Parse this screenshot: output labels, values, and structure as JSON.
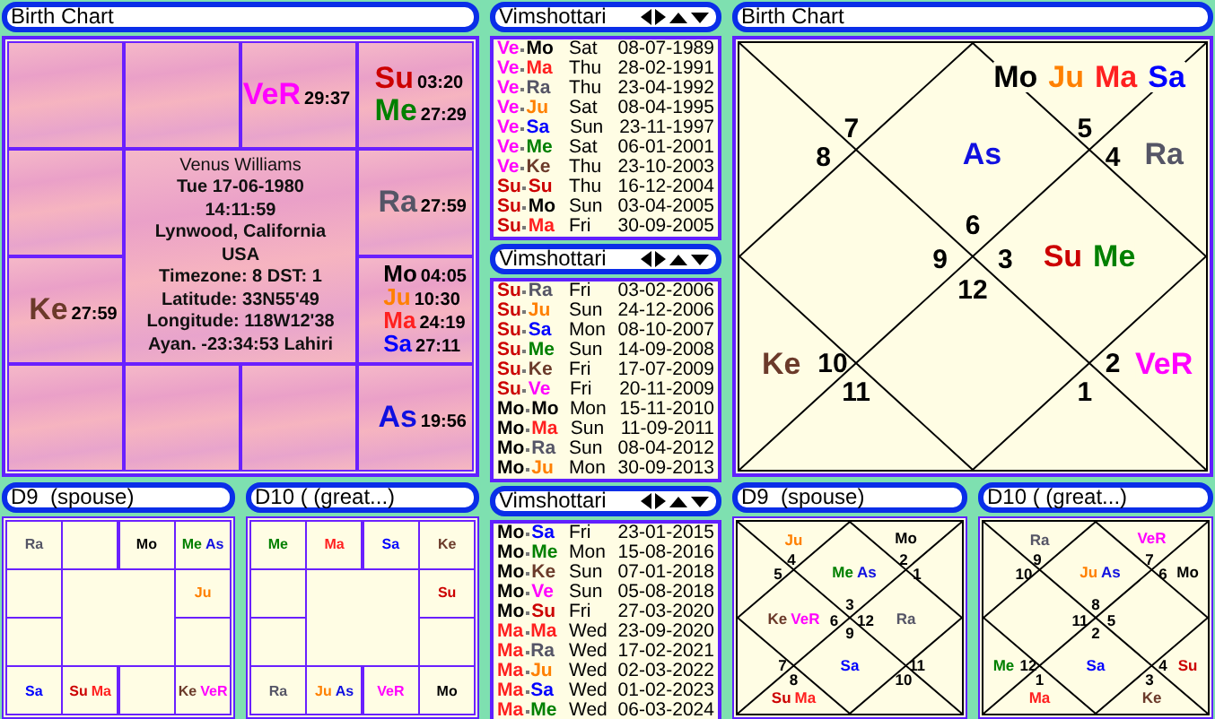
{
  "birth_chart_south": {
    "title": "Birth Chart",
    "name": "Venus Williams",
    "details": [
      "Tue 17-06-1980",
      "14:11:59",
      "Lynwood, California",
      "USA",
      "Timezone: 8 DST: 1",
      "Latitude: 33N55'49",
      "Longitude: 118W12'38",
      "Ayan. -23:34:53 Lahiri"
    ],
    "cells": [
      {},
      {},
      {
        "planets": [
          {
            "name": "VeR",
            "degree": "29:37",
            "color": "#ff00ff"
          }
        ]
      },
      {
        "planets": [
          {
            "name": "Su",
            "degree": "03:20",
            "color": "#cc0000"
          },
          {
            "name": "Me",
            "degree": "27:29",
            "color": "#008000"
          }
        ]
      },
      {},
      {
        "planets": [
          {
            "name": "Ra",
            "degree": "27:59",
            "color": "#555566"
          }
        ]
      },
      {
        "planets": [
          {
            "name": "Ke",
            "degree": "27:59",
            "color": "#6b3a2a"
          }
        ]
      },
      {
        "planets": [
          {
            "name": "Mo",
            "degree": "04:05",
            "color": "#000000"
          },
          {
            "name": "Ju",
            "degree": "10:30",
            "color": "#ff8000"
          },
          {
            "name": "Ma",
            "degree": "24:19",
            "color": "#ff2020"
          },
          {
            "name": "Sa",
            "degree": "27:11",
            "color": "#0000ff"
          }
        ]
      },
      {},
      {},
      {},
      {
        "planets": [
          {
            "name": "As",
            "degree": "19:56",
            "color": "#1010e0"
          }
        ]
      }
    ]
  },
  "dasha_lists": [
    {
      "title": "Vimshottari",
      "rows": [
        {
          "lords": [
            {
              "name": "Ve",
              "color": "#ff00ff"
            },
            {
              "name": "Mo",
              "color": "#000000"
            }
          ],
          "day": "Sat",
          "date": "08-07-1989"
        },
        {
          "lords": [
            {
              "name": "Ve",
              "color": "#ff00ff"
            },
            {
              "name": "Ma",
              "color": "#ff2020"
            }
          ],
          "day": "Thu",
          "date": "28-02-1991"
        },
        {
          "lords": [
            {
              "name": "Ve",
              "color": "#ff00ff"
            },
            {
              "name": "Ra",
              "color": "#555566"
            }
          ],
          "day": "Thu",
          "date": "23-04-1992"
        },
        {
          "lords": [
            {
              "name": "Ve",
              "color": "#ff00ff"
            },
            {
              "name": "Ju",
              "color": "#ff8000"
            }
          ],
          "day": "Sat",
          "date": "08-04-1995"
        },
        {
          "lords": [
            {
              "name": "Ve",
              "color": "#ff00ff"
            },
            {
              "name": "Sa",
              "color": "#0000ff"
            }
          ],
          "day": "Sun",
          "date": "23-11-1997"
        },
        {
          "lords": [
            {
              "name": "Ve",
              "color": "#ff00ff"
            },
            {
              "name": "Me",
              "color": "#008000"
            }
          ],
          "day": "Sat",
          "date": "06-01-2001"
        },
        {
          "lords": [
            {
              "name": "Ve",
              "color": "#ff00ff"
            },
            {
              "name": "Ke",
              "color": "#6b3a2a"
            }
          ],
          "day": "Thu",
          "date": "23-10-2003"
        },
        {
          "lords": [
            {
              "name": "Su",
              "color": "#cc0000"
            },
            {
              "name": "Su",
              "color": "#cc0000"
            }
          ],
          "day": "Thu",
          "date": "16-12-2004"
        },
        {
          "lords": [
            {
              "name": "Su",
              "color": "#cc0000"
            },
            {
              "name": "Mo",
              "color": "#000000"
            }
          ],
          "day": "Sun",
          "date": "03-04-2005"
        },
        {
          "lords": [
            {
              "name": "Su",
              "color": "#cc0000"
            },
            {
              "name": "Ma",
              "color": "#ff2020"
            }
          ],
          "day": "Fri",
          "date": "30-09-2005"
        }
      ]
    },
    {
      "title": "Vimshottari",
      "rows": [
        {
          "lords": [
            {
              "name": "Su",
              "color": "#cc0000"
            },
            {
              "name": "Ra",
              "color": "#555566"
            }
          ],
          "day": "Fri",
          "date": "03-02-2006"
        },
        {
          "lords": [
            {
              "name": "Su",
              "color": "#cc0000"
            },
            {
              "name": "Ju",
              "color": "#ff8000"
            }
          ],
          "day": "Sun",
          "date": "24-12-2006"
        },
        {
          "lords": [
            {
              "name": "Su",
              "color": "#cc0000"
            },
            {
              "name": "Sa",
              "color": "#0000ff"
            }
          ],
          "day": "Mon",
          "date": "08-10-2007"
        },
        {
          "lords": [
            {
              "name": "Su",
              "color": "#cc0000"
            },
            {
              "name": "Me",
              "color": "#008000"
            }
          ],
          "day": "Sun",
          "date": "14-09-2008"
        },
        {
          "lords": [
            {
              "name": "Su",
              "color": "#cc0000"
            },
            {
              "name": "Ke",
              "color": "#6b3a2a"
            }
          ],
          "day": "Fri",
          "date": "17-07-2009"
        },
        {
          "lords": [
            {
              "name": "Su",
              "color": "#cc0000"
            },
            {
              "name": "Ve",
              "color": "#ff00ff"
            }
          ],
          "day": "Fri",
          "date": "20-11-2009"
        },
        {
          "lords": [
            {
              "name": "Mo",
              "color": "#000000"
            },
            {
              "name": "Mo",
              "color": "#000000"
            }
          ],
          "day": "Mon",
          "date": "15-11-2010"
        },
        {
          "lords": [
            {
              "name": "Mo",
              "color": "#000000"
            },
            {
              "name": "Ma",
              "color": "#ff2020"
            }
          ],
          "day": "Sun",
          "date": "11-09-2011"
        },
        {
          "lords": [
            {
              "name": "Mo",
              "color": "#000000"
            },
            {
              "name": "Ra",
              "color": "#555566"
            }
          ],
          "day": "Sun",
          "date": "08-04-2012"
        },
        {
          "lords": [
            {
              "name": "Mo",
              "color": "#000000"
            },
            {
              "name": "Ju",
              "color": "#ff8000"
            }
          ],
          "day": "Mon",
          "date": "30-09-2013"
        }
      ]
    },
    {
      "title": "Vimshottari",
      "rows": [
        {
          "lords": [
            {
              "name": "Mo",
              "color": "#000000"
            },
            {
              "name": "Sa",
              "color": "#0000ff"
            }
          ],
          "day": "Fri",
          "date": "23-01-2015"
        },
        {
          "lords": [
            {
              "name": "Mo",
              "color": "#000000"
            },
            {
              "name": "Me",
              "color": "#008000"
            }
          ],
          "day": "Mon",
          "date": "15-08-2016"
        },
        {
          "lords": [
            {
              "name": "Mo",
              "color": "#000000"
            },
            {
              "name": "Ke",
              "color": "#6b3a2a"
            }
          ],
          "day": "Sun",
          "date": "07-01-2018"
        },
        {
          "lords": [
            {
              "name": "Mo",
              "color": "#000000"
            },
            {
              "name": "Ve",
              "color": "#ff00ff"
            }
          ],
          "day": "Sun",
          "date": "05-08-2018"
        },
        {
          "lords": [
            {
              "name": "Mo",
              "color": "#000000"
            },
            {
              "name": "Su",
              "color": "#cc0000"
            }
          ],
          "day": "Fri",
          "date": "27-03-2020"
        },
        {
          "lords": [
            {
              "name": "Ma",
              "color": "#ff2020"
            },
            {
              "name": "Ma",
              "color": "#ff2020"
            }
          ],
          "day": "Wed",
          "date": "23-09-2020"
        },
        {
          "lords": [
            {
              "name": "Ma",
              "color": "#ff2020"
            },
            {
              "name": "Ra",
              "color": "#555566"
            }
          ],
          "day": "Wed",
          "date": "17-02-2021"
        },
        {
          "lords": [
            {
              "name": "Ma",
              "color": "#ff2020"
            },
            {
              "name": "Ju",
              "color": "#ff8000"
            }
          ],
          "day": "Wed",
          "date": "02-03-2022"
        },
        {
          "lords": [
            {
              "name": "Ma",
              "color": "#ff2020"
            },
            {
              "name": "Sa",
              "color": "#0000ff"
            }
          ],
          "day": "Wed",
          "date": "01-02-2023"
        },
        {
          "lords": [
            {
              "name": "Ma",
              "color": "#ff2020"
            },
            {
              "name": "Me",
              "color": "#008000"
            }
          ],
          "day": "Wed",
          "date": "06-03-2024"
        }
      ]
    }
  ],
  "birth_chart_north": {
    "title": "Birth Chart",
    "houses": [
      {
        "number": "7"
      },
      {
        "number": "5",
        "planets": [
          {
            "name": "Mo",
            "color": "#000000"
          },
          {
            "name": "Ju",
            "color": "#ff8000"
          },
          {
            "name": "Ma",
            "color": "#ff2020"
          },
          {
            "name": "Sa",
            "color": "#0000ff"
          }
        ]
      },
      {
        "number": "8"
      },
      {
        "number": "6",
        "planets": [
          {
            "name": "As",
            "color": "#1010e0"
          }
        ]
      },
      {
        "number": "4",
        "planets": [
          {
            "name": "Ra",
            "color": "#555566"
          }
        ]
      },
      {
        "number": "9"
      },
      {
        "number": "3",
        "planets": [
          {
            "name": "Su",
            "color": "#cc0000"
          },
          {
            "name": "Me",
            "color": "#008000"
          }
        ]
      },
      {
        "number": "12"
      },
      {
        "number": "10",
        "planets": [
          {
            "name": "Ke",
            "color": "#6b3a2a"
          }
        ]
      },
      {
        "number": "2",
        "planets": [
          {
            "name": "VeR",
            "color": "#ff00ff"
          }
        ]
      },
      {
        "number": "11"
      },
      {
        "number": "1"
      }
    ]
  },
  "divisional_charts": [
    {
      "kind": "south",
      "title": "D9  (spouse)",
      "cells": [
        {
          "planets": [
            {
              "name": "Ra",
              "color": "#555566"
            }
          ]
        },
        {},
        {
          "planets": [
            {
              "name": "Mo",
              "color": "#000000"
            }
          ]
        },
        {
          "planets": [
            {
              "name": "Me",
              "color": "#008000"
            },
            {
              "name": "As",
              "color": "#1010e0"
            }
          ]
        },
        {},
        {
          "planets": [
            {
              "name": "Ju",
              "color": "#ff8000"
            }
          ]
        },
        {},
        {},
        {
          "planets": [
            {
              "name": "Sa",
              "color": "#0000ff"
            }
          ]
        },
        {
          "planets": [
            {
              "name": "Su",
              "color": "#cc0000"
            },
            {
              "name": "Ma",
              "color": "#ff2020"
            }
          ]
        },
        {},
        {
          "planets": [
            {
              "name": "Ke",
              "color": "#6b3a2a"
            },
            {
              "name": "VeR",
              "color": "#ff00ff"
            }
          ]
        }
      ]
    },
    {
      "kind": "south",
      "title": "D10 ( (great...)",
      "cells": [
        {
          "planets": [
            {
              "name": "Me",
              "color": "#008000"
            }
          ]
        },
        {
          "planets": [
            {
              "name": "Ma",
              "color": "#ff2020"
            }
          ]
        },
        {
          "planets": [
            {
              "name": "Sa",
              "color": "#0000ff"
            }
          ]
        },
        {
          "planets": [
            {
              "name": "Ke",
              "color": "#6b3a2a"
            }
          ]
        },
        {},
        {
          "planets": [
            {
              "name": "Su",
              "color": "#cc0000"
            }
          ]
        },
        {},
        {},
        {
          "planets": [
            {
              "name": "Ra",
              "color": "#555566"
            }
          ]
        },
        {
          "planets": [
            {
              "name": "Ju",
              "color": "#ff8000"
            },
            {
              "name": "As",
              "color": "#1010e0"
            }
          ]
        },
        {
          "planets": [
            {
              "name": "VeR",
              "color": "#ff00ff"
            }
          ]
        },
        {
          "planets": [
            {
              "name": "Mo",
              "color": "#000000"
            }
          ]
        }
      ]
    },
    {
      "kind": "north",
      "title": "D9  (spouse)",
      "houses": [
        {
          "number": "4",
          "planets": [
            {
              "name": "Ju",
              "color": "#ff8000"
            }
          ]
        },
        {
          "number": "2",
          "planets": [
            {
              "name": "Mo",
              "color": "#000000"
            }
          ]
        },
        {
          "number": "5"
        },
        {
          "number": "3",
          "planets": [
            {
              "name": "Me",
              "color": "#008000"
            },
            {
              "name": "As",
              "color": "#1010e0"
            }
          ]
        },
        {
          "number": "1"
        },
        {
          "number": "6",
          "planets": [
            {
              "name": "Ke",
              "color": "#6b3a2a"
            },
            {
              "name": "VeR",
              "color": "#ff00ff"
            }
          ]
        },
        {
          "number": "12",
          "planets": [
            {
              "name": "Ra",
              "color": "#555566"
            }
          ]
        },
        {
          "number": "7"
        },
        {
          "number": "9",
          "planets": [
            {
              "name": "Sa",
              "color": "#0000ff"
            }
          ]
        },
        {
          "number": "11"
        },
        {
          "number": "8",
          "planets": [
            {
              "name": "Su",
              "color": "#cc0000"
            },
            {
              "name": "Ma",
              "color": "#ff2020"
            }
          ]
        },
        {
          "number": "10"
        }
      ]
    },
    {
      "kind": "north",
      "title": "D10 ( (great...)",
      "houses": [
        {
          "number": "9",
          "planets": [
            {
              "name": "Ra",
              "color": "#555566"
            }
          ]
        },
        {
          "number": "7",
          "planets": [
            {
              "name": "VeR",
              "color": "#ff00ff"
            }
          ]
        },
        {
          "number": "10"
        },
        {
          "number": "8",
          "planets": [
            {
              "name": "Ju",
              "color": "#ff8000"
            },
            {
              "name": "As",
              "color": "#1010e0"
            }
          ]
        },
        {
          "number": "6",
          "planets": [
            {
              "name": "Mo",
              "color": "#000000"
            }
          ]
        },
        {
          "number": "11"
        },
        {
          "number": "5"
        },
        {
          "number": "12",
          "planets": [
            {
              "name": "Me",
              "color": "#008000"
            }
          ]
        },
        {
          "number": "2",
          "planets": [
            {
              "name": "Sa",
              "color": "#0000ff"
            }
          ]
        },
        {
          "number": "4",
          "planets": [
            {
              "name": "Su",
              "color": "#cc0000"
            }
          ]
        },
        {
          "number": "1",
          "planets": [
            {
              "name": "Ma",
              "color": "#ff2020"
            }
          ]
        },
        {
          "number": "3",
          "planets": [
            {
              "name": "Ke",
              "color": "#6b3a2a"
            }
          ]
        }
      ]
    }
  ]
}
